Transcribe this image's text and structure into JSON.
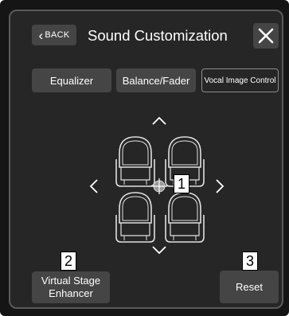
{
  "header": {
    "back_label": "BACK",
    "title": "Sound Customization"
  },
  "tabs": [
    {
      "label": "Equalizer"
    },
    {
      "label": "Balance/Fader"
    },
    {
      "label": "Vocal Image Control"
    }
  ],
  "callouts": [
    "1",
    "2",
    "3"
  ],
  "buttons": {
    "virtual_stage_line1": "Virtual Stage",
    "virtual_stage_line2": "Enhancer",
    "reset": "Reset"
  },
  "icons": {
    "close": "close-icon",
    "up": "chevron-up-icon",
    "down": "chevron-down-icon",
    "left": "chevron-left-icon",
    "right": "chevron-right-icon",
    "position_marker": "crosshair-icon",
    "seat": "car-seat-icon"
  },
  "colors": {
    "background": "#262626",
    "button": "#454545",
    "text": "#ffffff",
    "outline": "#8c8c8c"
  }
}
